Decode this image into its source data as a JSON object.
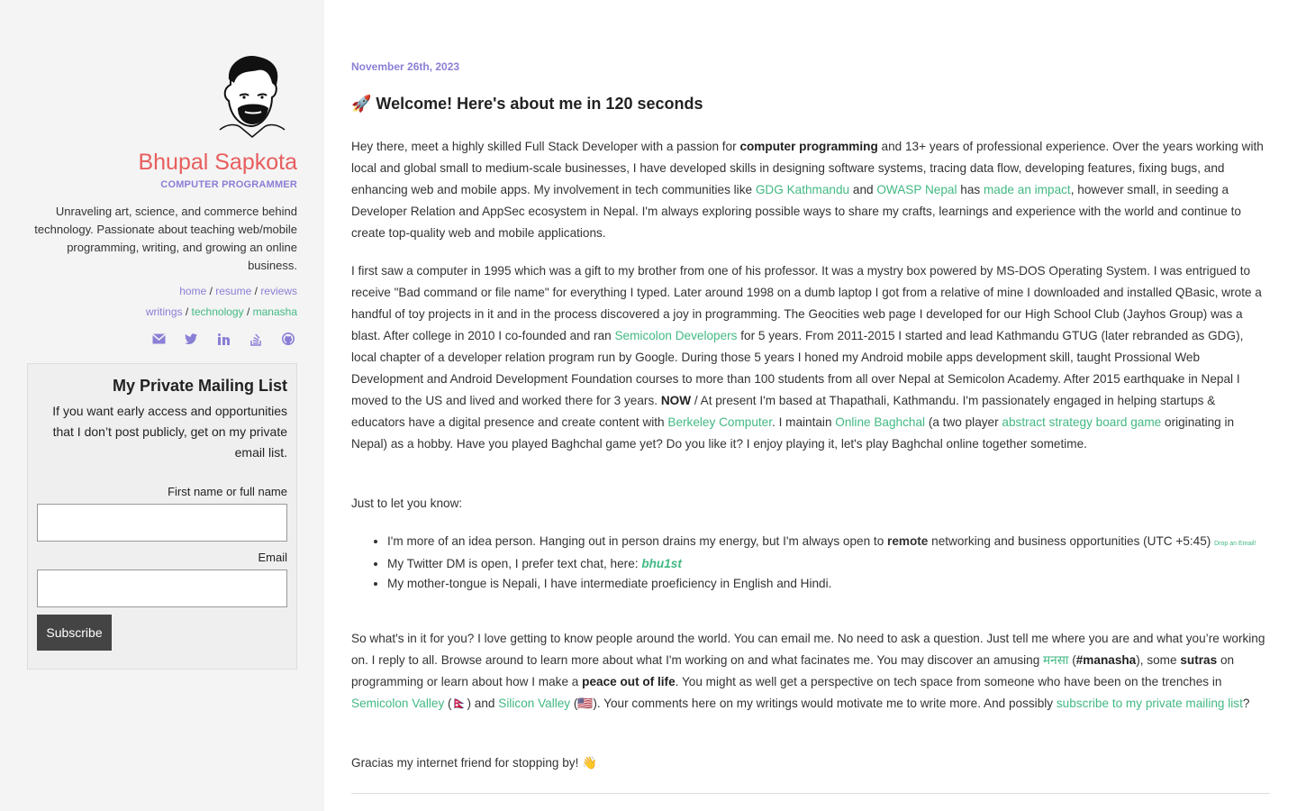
{
  "sidebar": {
    "name": "Bhupal Sapkota",
    "role": "COMPUTER PROGRAMMER",
    "bio": "Unraveling art, science, and commerce behind technology. Passionate about teaching web/mobile programming, writing, and growing an online business.",
    "nav": {
      "home": "home",
      "resume": "resume",
      "reviews": "reviews",
      "writings": "writings",
      "technology": "technology",
      "manasha": "manasha",
      "sep": "/"
    },
    "social_icons": [
      "envelope-icon",
      "twitter-icon",
      "linkedin-icon",
      "stackoverflow-icon",
      "github-icon"
    ],
    "mailing": {
      "title": "My Private Mailing List",
      "description": "If you want early access and opportunities that I don’t post publicly, get on my private email list.",
      "first_name_label": "First name or full name",
      "email_label": "Email",
      "subscribe_label": "Subscribe"
    }
  },
  "main": {
    "date": "November 26th, 2023",
    "title": "🚀 Welcome! Here's about me in 120 seconds",
    "p1": {
      "a": "Hey there, meet a highly skilled Full Stack Developer with a passion for ",
      "b": "computer programming",
      "c": " and 13+ years of professional experience. Over the years working with local and global small to medium-scale businesses, I have developed skills in designing software systems, tracing data flow, developing features, fixing bugs, and enhancing web and mobile apps. My involvement in tech communities like ",
      "gdg": "GDG Kathmandu",
      "d": " and ",
      "owasp": "OWASP Nepal",
      "e": " has ",
      "impact": "made an impact",
      "f": ", however small, in seeding a Developer Relation and AppSec ecosystem in Nepal. I'm always exploring possible ways to share my crafts, learnings and experience with the world and continue to create top-quality web and mobile applications."
    },
    "p2": {
      "a": "I first saw a computer in 1995 which was a gift to my brother from one of his professor. It was a mystry box powered by MS-DOS Operating System. I was entrigued to receive \"Bad command or file name\" for everything I typed. Later around 1998 on a dumb laptop I got from a relative of mine I downloaded and installed QBasic, wrote a handful of toy projects in it and in the process discovered a joy in programming. The Geocities web page I developed for our High School Club (Jayhos Group) was a blast. After college in 2010 I co-founded and ran ",
      "semicolon": "Semicolon Developers",
      "b": " for 5 years. From 2011-2015 I started and lead Kathmandu GTUG (later rebranded as GDG), local chapter of a developer relation program run by Google. During those 5 years I honed my Android mobile apps development skill, taught Prossional Web Development and Android Development Foundation courses to more than 100 students from all over Nepal at Semicolon Academy. After 2015 earthquake in Nepal I moved to the US and lived and worked there for 3 years. ",
      "now": "NOW",
      "c": " / At present I'm based at Thapathali, Kathmandu. I'm passionately engaged in helping startups & educators have a digital presence and create content with ",
      "berkeley": "Berkeley Computer",
      "d": ". I maintain ",
      "baghchal": "Online Baghchal",
      "e": " (a two player ",
      "abstract": "abstract strategy board game",
      "f": " originating in Nepal) as a hobby. Have you played Baghchal game yet? Do you like it? I enjoy playing it, let's play Baghchal online together sometime."
    },
    "p3": "Just to let you know:",
    "list": {
      "item1_a": "I'm more of an idea person. Hanging out in person drains my energy, but I'm always open to ",
      "item1_b": "remote",
      "item1_c": " networking and business opportunities (UTC +5:45) ",
      "item1_link": "Drop an Email!",
      "item2_a": "My Twitter DM is open, I prefer text chat, here: ",
      "item2_link": "bhu1st",
      "item3": "My mother-tongue is Nepali, I have intermediate proeficiency in English and Hindi."
    },
    "p4": {
      "a": "So what's in it for you? I love getting to know people around the world. You can email me. No need to ask a question. Just tell me where you are and what you’re working on. I reply to all. Browse around to learn more about what I'm working on and what facinates me. You may discover an amusing ",
      "manasha_link": "मनसा",
      "b": " (",
      "manasha_tag": "#manasha",
      "c": "), some ",
      "sutras": "sutras",
      "d": " on programming or learn about how I make a ",
      "peace": "peace out of life",
      "e": ". You might as well get a perspective on tech space from someone who have been on the trenches in ",
      "semicolon_valley": "Semicolon Valley",
      "f": " (🇳🇵) and ",
      "silicon_valley": "Silicon Valley",
      "g": " (🇺🇸). Your comments here on my writings would motivate me to write more. And possibly ",
      "subscribe_link": "subscribe to my private mailing list",
      "h": "?"
    },
    "p5": "Gracias my internet friend for stopping by! 👋"
  }
}
